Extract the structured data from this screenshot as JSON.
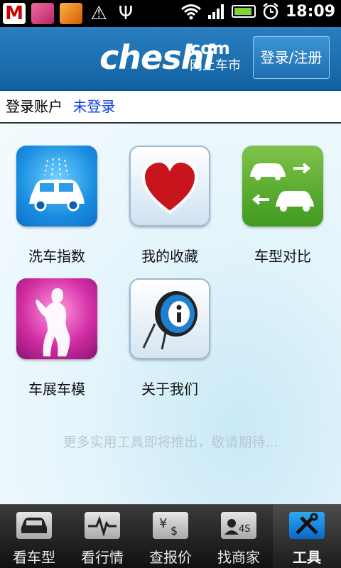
{
  "status_bar": {
    "time": "18:09",
    "icons": [
      "gmail-icon",
      "game-icon",
      "app-icon",
      "alert-icon",
      "usb-icon",
      "wifi-icon",
      "signal-icon",
      "battery-icon",
      "alarm-icon"
    ]
  },
  "header": {
    "logo_main": "cheshi",
    "logo_com": "com",
    "logo_cn": "网上车市",
    "login_button": "登录/注册",
    "colors": {
      "bar": "#1a6fb3",
      "button": "#2b81c4"
    }
  },
  "account": {
    "label": "登录账户",
    "status": "未登录",
    "status_color": "#0a3de6"
  },
  "tools": [
    {
      "label": "洗车指数",
      "icon": "car-wash-icon"
    },
    {
      "label": "我的收藏",
      "icon": "heart-icon"
    },
    {
      "label": "车型对比",
      "icon": "car-compare-icon"
    },
    {
      "label": "车展车模",
      "icon": "car-model-icon"
    },
    {
      "label": "关于我们",
      "icon": "info-icon"
    }
  ],
  "hint": "更多实用工具即将推出，敬请期待...",
  "tabs": [
    {
      "label": "看车型",
      "icon": "car-icon",
      "active": false
    },
    {
      "label": "看行情",
      "icon": "pulse-icon",
      "active": false
    },
    {
      "label": "查报价",
      "icon": "price-icon",
      "active": false
    },
    {
      "label": "找商家",
      "icon": "dealer-icon",
      "active": false
    },
    {
      "label": "工具",
      "icon": "tools-icon",
      "active": true
    }
  ]
}
